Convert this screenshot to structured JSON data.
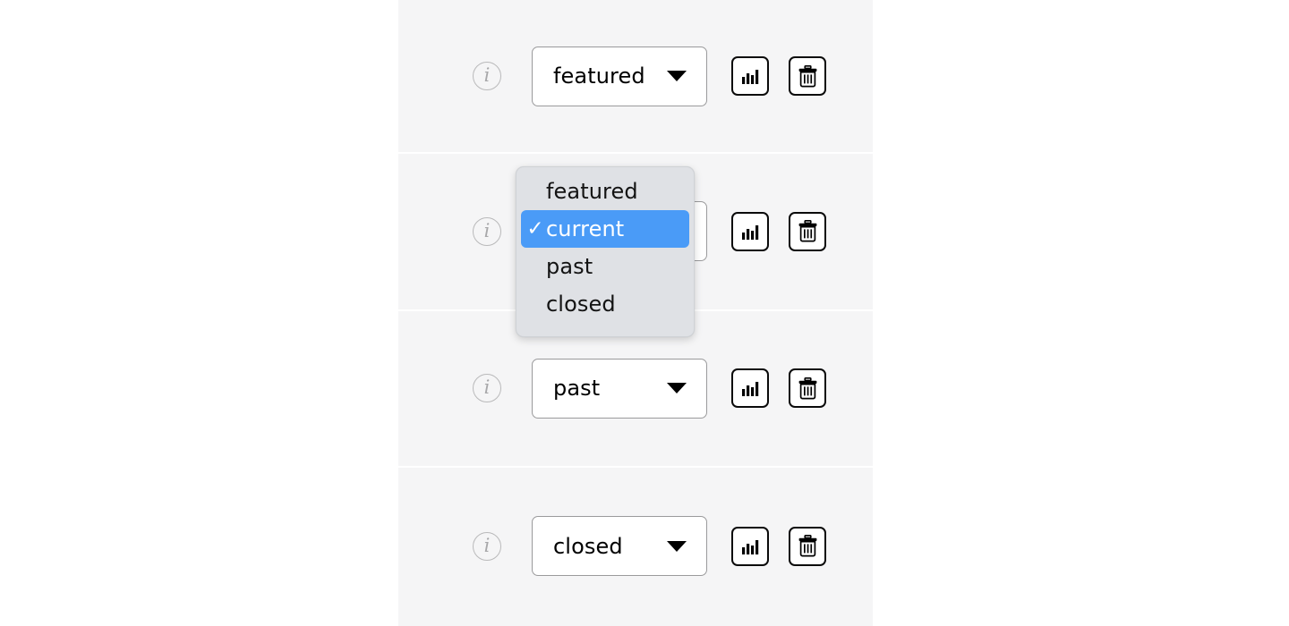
{
  "panel": {
    "rows": [
      {
        "info_icon": "info-icon",
        "select_value": "featured",
        "chart_button": "chart-icon",
        "delete_button": "trash-icon"
      },
      {
        "info_icon": "info-icon",
        "select_value": "current",
        "chart_button": "chart-icon",
        "delete_button": "trash-icon"
      },
      {
        "info_icon": "info-icon",
        "select_value": "past",
        "chart_button": "chart-icon",
        "delete_button": "trash-icon"
      },
      {
        "info_icon": "info-icon",
        "select_value": "closed",
        "chart_button": "chart-icon",
        "delete_button": "trash-icon"
      }
    ]
  },
  "dropdown": {
    "open_for_row": 2,
    "selected": "current",
    "check_glyph": "✓",
    "options": [
      {
        "label": "featured",
        "selected": false
      },
      {
        "label": "current",
        "selected": true
      },
      {
        "label": "past",
        "selected": false
      },
      {
        "label": "closed",
        "selected": false
      }
    ]
  },
  "icons": {
    "info": "i",
    "dropdown_arrow": "chevron-down-icon"
  },
  "colors": {
    "page_background": "#ffffff",
    "panel_background": "#f5f5f6",
    "row_divider": "#ffffff",
    "select_border": "#9a9a9c",
    "select_background": "#ffffff",
    "icon_button_border": "#0b0b0b",
    "info_icon": "#b9b9ba",
    "popup_background": "#dfe1e5",
    "popup_highlight": "#4a9bf7",
    "popup_highlight_text": "#ffffff",
    "text": "#131313"
  }
}
